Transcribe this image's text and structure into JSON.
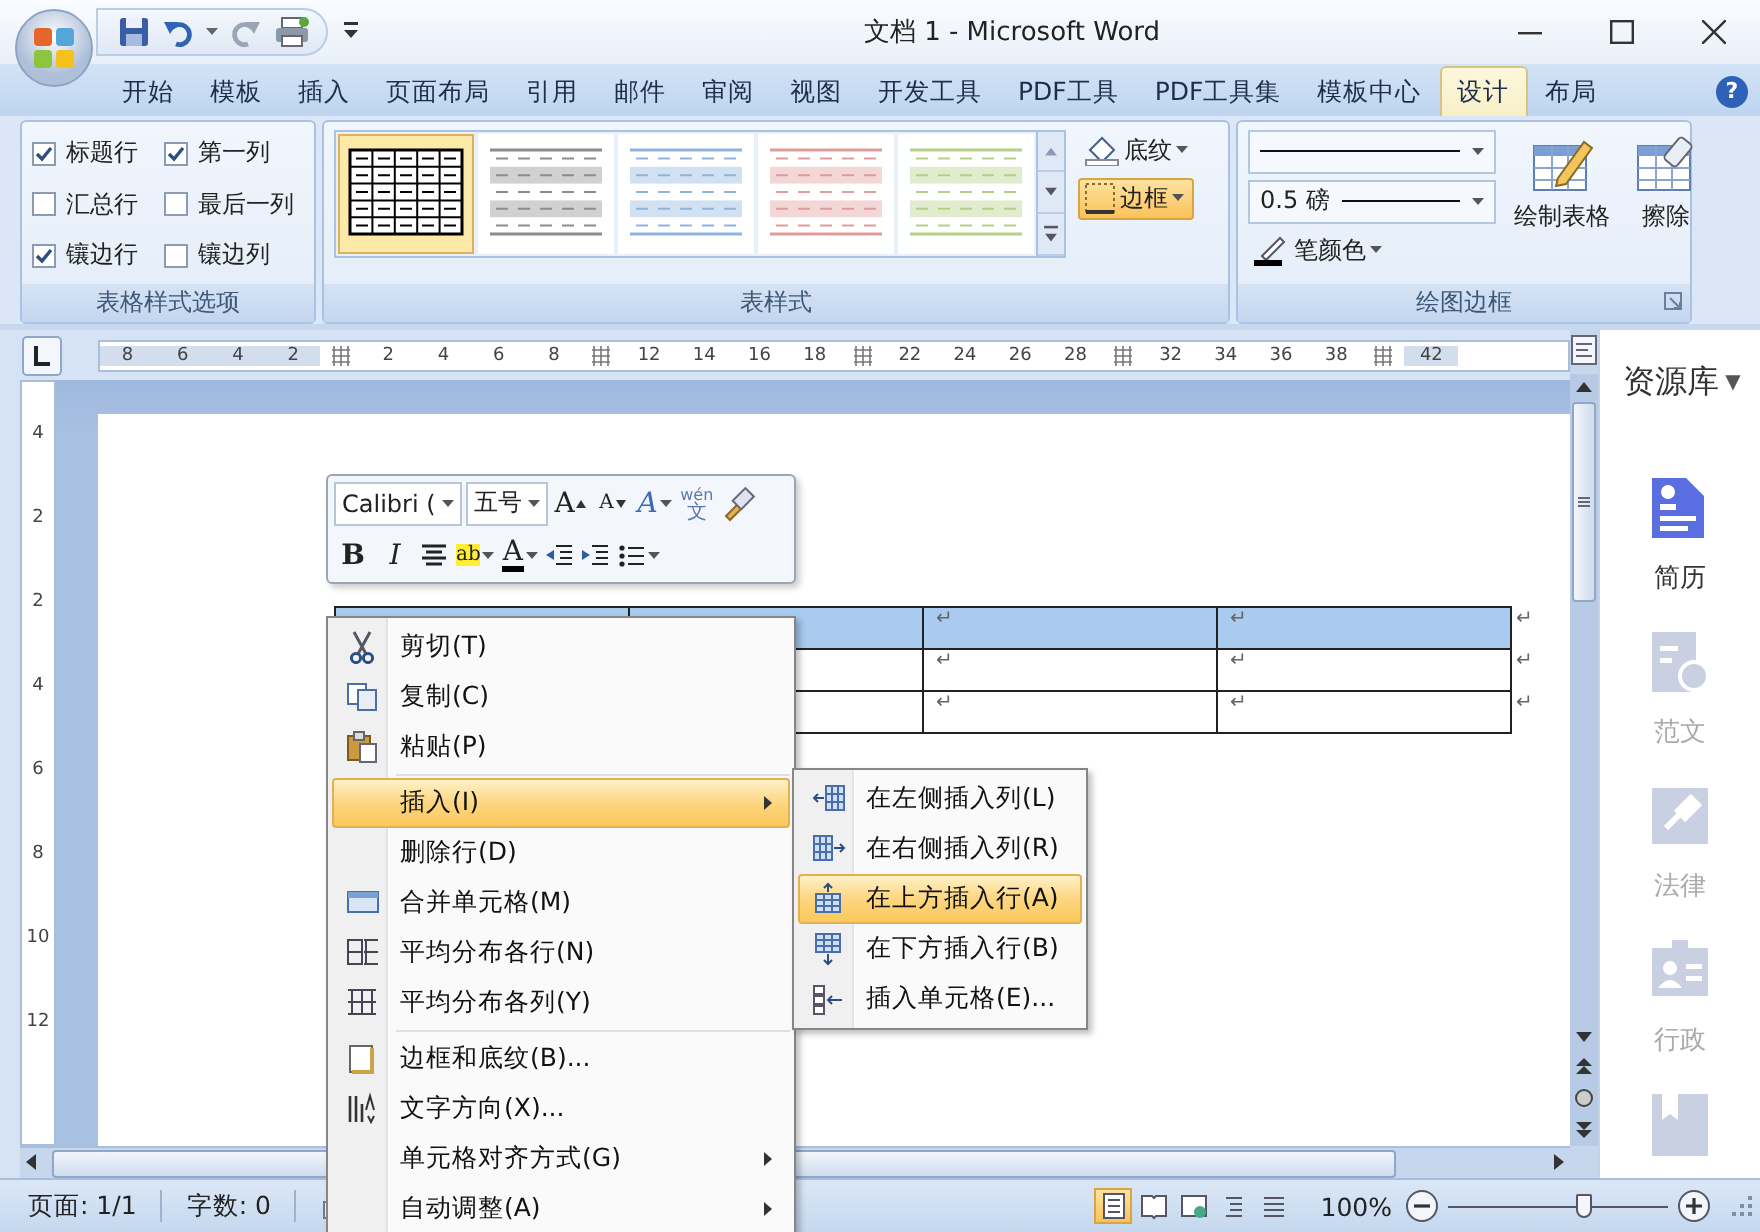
{
  "window": {
    "title": "文档 1 - Microsoft Word"
  },
  "tabs": [
    {
      "label": "开始",
      "selected": false
    },
    {
      "label": "模板",
      "selected": false
    },
    {
      "label": "插入",
      "selected": false
    },
    {
      "label": "页面布局",
      "selected": false
    },
    {
      "label": "引用",
      "selected": false
    },
    {
      "label": "邮件",
      "selected": false
    },
    {
      "label": "审阅",
      "selected": false
    },
    {
      "label": "视图",
      "selected": false
    },
    {
      "label": "开发工具",
      "selected": false
    },
    {
      "label": "PDF工具",
      "selected": false
    },
    {
      "label": "PDF工具集",
      "selected": false
    },
    {
      "label": "模板中心",
      "selected": false
    },
    {
      "label": "设计",
      "selected": true
    },
    {
      "label": "布局",
      "selected": false
    }
  ],
  "help": "?",
  "table_style_options": {
    "title": "表格样式选项",
    "options": [
      {
        "label": "标题行",
        "checked": true
      },
      {
        "label": "第一列",
        "checked": true
      },
      {
        "label": "汇总行",
        "checked": false
      },
      {
        "label": "最后一列",
        "checked": false
      },
      {
        "label": "镶边行",
        "checked": true
      },
      {
        "label": "镶边列",
        "checked": false
      }
    ]
  },
  "table_styles": {
    "title": "表样式",
    "styles": [
      {
        "kind": "grid",
        "color": "#000000",
        "selected": true
      },
      {
        "kind": "banded",
        "color": "#8c8c8c",
        "selected": false
      },
      {
        "kind": "banded",
        "color": "#8eb4de",
        "selected": false
      },
      {
        "kind": "banded",
        "color": "#e29a9a",
        "selected": false
      },
      {
        "kind": "banded",
        "color": "#b4cf86",
        "selected": false
      }
    ],
    "buttons": [
      {
        "label": "底纹",
        "selected": false
      },
      {
        "label": "边框",
        "selected": true
      }
    ]
  },
  "draw_borders": {
    "title": "绘图边框",
    "line_weight": "0.5 磅",
    "pen_color": "笔颜色",
    "tools": [
      "绘制表格",
      "擦除"
    ]
  },
  "ruler": {
    "horizontal": [
      [
        "8",
        "6",
        "4",
        "2"
      ],
      [
        "2",
        "4",
        "6",
        "8"
      ],
      [
        "12",
        "14",
        "16",
        "18"
      ],
      [
        "22",
        "24",
        "26",
        "28"
      ],
      [
        "32",
        "34",
        "36",
        "38"
      ],
      [
        "42"
      ]
    ],
    "vertical": [
      "4",
      "2",
      "2",
      "4",
      "6",
      "8",
      "10",
      "12"
    ]
  },
  "table": {
    "rows": [
      {
        "selected": true,
        "marks": [
          "↵",
          "↵",
          "↵"
        ]
      },
      {
        "selected": false,
        "marks": [
          "↵",
          "↵",
          "↵"
        ]
      },
      {
        "selected": false,
        "marks": [
          "↵",
          "↵",
          "↵"
        ]
      }
    ]
  },
  "mini_toolbar": {
    "font": "Calibri (",
    "size": "五号",
    "row_1": [
      {
        "kind": "grow",
        "glyph": "A"
      },
      {
        "kind": "shrink",
        "glyph": "A"
      },
      {
        "kind": "style",
        "glyph": "A"
      },
      {
        "kind": "phonetic",
        "ruby": "wén",
        "glyph": "文"
      },
      {
        "kind": "painter"
      }
    ],
    "row_2": [
      {
        "kind": "bold",
        "glyph": "B"
      },
      {
        "kind": "italic",
        "glyph": "I"
      },
      {
        "kind": "center"
      },
      {
        "kind": "highlight",
        "glyph": "ab"
      },
      {
        "kind": "fontcolor",
        "glyph": "A"
      },
      {
        "kind": "outdent"
      },
      {
        "kind": "indent"
      },
      {
        "kind": "bullets"
      }
    ]
  },
  "context_menu": {
    "groups": [
      [
        {
          "label": "剪切(T)",
          "selected": false,
          "submenu": false
        },
        {
          "label": "复制(C)",
          "selected": false,
          "submenu": false
        },
        {
          "label": "粘贴(P)",
          "selected": false,
          "submenu": false
        }
      ],
      [
        {
          "label": "插入(I)",
          "selected": true,
          "submenu": true
        },
        {
          "label": "删除行(D)",
          "selected": false,
          "submenu": false
        },
        {
          "label": "合并单元格(M)",
          "selected": false,
          "submenu": false
        },
        {
          "label": "平均分布各行(N)",
          "selected": false,
          "submenu": false
        },
        {
          "label": "平均分布各列(Y)",
          "selected": false,
          "submenu": false
        }
      ],
      [
        {
          "label": "边框和底纹(B)...",
          "selected": false,
          "submenu": false
        },
        {
          "label": "文字方向(X)...",
          "selected": false,
          "submenu": false
        },
        {
          "label": "单元格对齐方式(G)",
          "selected": false,
          "submenu": true
        },
        {
          "label": "自动调整(A)",
          "selected": false,
          "submenu": true
        }
      ]
    ]
  },
  "submenu": {
    "items": [
      {
        "label": "在左侧插入列(L)",
        "selected": false
      },
      {
        "label": "在右侧插入列(R)",
        "selected": false
      },
      {
        "label": "在上方插入行(A)",
        "selected": true
      },
      {
        "label": "在下方插入行(B)",
        "selected": false
      },
      {
        "label": "插入单元格(E)...",
        "selected": false
      }
    ]
  },
  "side_panel": {
    "title": "资源库",
    "caret": "▼",
    "items": [
      {
        "label": "简历",
        "selected": true
      },
      {
        "label": "范文",
        "selected": false
      },
      {
        "label": "法律",
        "selected": false
      },
      {
        "label": "行政",
        "selected": false
      }
    ]
  },
  "status_bar": {
    "page": "页面: 1/1",
    "words": "字数: 0",
    "views": [
      {
        "selected": true
      },
      {
        "selected": false
      },
      {
        "selected": false
      },
      {
        "selected": false
      },
      {
        "selected": false
      }
    ],
    "zoom": "100%",
    "zoom_slider": {
      "level": 0.62
    }
  }
}
